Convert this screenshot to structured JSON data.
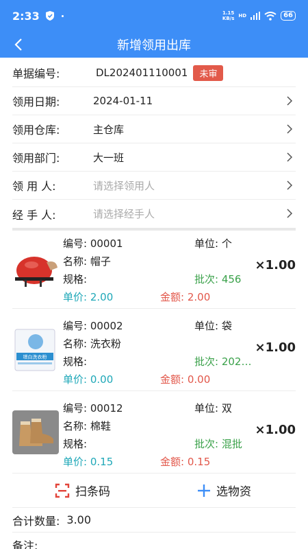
{
  "status": {
    "time": "2:33",
    "speed": "1.15\nKB/s",
    "hd": "HD",
    "battery": "66"
  },
  "nav": {
    "title": "新增领用出库"
  },
  "form": {
    "doc_no": {
      "label": "单据编号:",
      "value": "DL202401110001",
      "badge": "未审"
    },
    "date": {
      "label": "领用日期:",
      "value": "2024-01-11"
    },
    "warehouse": {
      "label": "领用仓库:",
      "value": "主仓库"
    },
    "department": {
      "label": "领用部门:",
      "value": "大一班"
    },
    "receiver": {
      "label": "领 用 人:",
      "placeholder": "请选择领用人"
    },
    "handler": {
      "label": "经 手 人:",
      "placeholder": "请选择经手人"
    }
  },
  "items": [
    {
      "code_label": "编号:",
      "code": "00001",
      "unit_label": "单位:",
      "unit": "个",
      "name_label": "名称:",
      "name": "帽子",
      "spec_label": "规格:",
      "batch_label": "批次:",
      "batch": "456",
      "price_label": "单价:",
      "price": "2.00",
      "amount_label": "金额:",
      "amount": "2.00",
      "qty": "×1.00",
      "icon": "helmet"
    },
    {
      "code_label": "编号:",
      "code": "00002",
      "unit_label": "单位:",
      "unit": "袋",
      "name_label": "名称:",
      "name": "洗衣粉",
      "spec_label": "规格:",
      "batch_label": "批次:",
      "batch": "202…",
      "price_label": "单价:",
      "price": "0.00",
      "amount_label": "金额:",
      "amount": "0.00",
      "qty": "×1.00",
      "icon": "detergent",
      "pack_text": "增白洗衣粉"
    },
    {
      "code_label": "编号:",
      "code": "00012",
      "unit_label": "单位:",
      "unit": "双",
      "name_label": "名称:",
      "name": "棉鞋",
      "spec_label": "规格:",
      "batch_label": "批次:",
      "batch": "混批",
      "price_label": "单价:",
      "price": "0.15",
      "amount_label": "金额:",
      "amount": "0.15",
      "qty": "×1.00",
      "icon": "boots"
    }
  ],
  "actions": {
    "scan": "扫条码",
    "select": "选物资"
  },
  "summary": {
    "total_label": "合计数量:",
    "total": "3.00",
    "remark_label": "备注:"
  },
  "colors": {
    "primary": "#3d8ef7",
    "badge": "#e25a4a",
    "green": "#3aa14a",
    "teal": "#1fa8b8",
    "red": "#e2574a"
  }
}
